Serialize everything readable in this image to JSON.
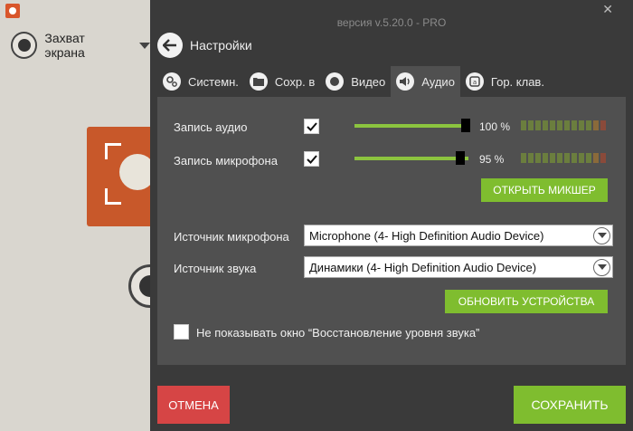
{
  "background_app": {
    "capture_label": "Захват экрана"
  },
  "dialog": {
    "version": "версия v.5.20.0 - PRO",
    "title": "Настройки",
    "tabs": [
      {
        "label": "Системн.",
        "icon": "gear-icon"
      },
      {
        "label": "Сохр. в",
        "icon": "folder-icon"
      },
      {
        "label": "Видео",
        "icon": "record-icon"
      },
      {
        "label": "Аудио",
        "icon": "speaker-icon",
        "active": true
      },
      {
        "label": "Гор. клав.",
        "icon": "hotkey-icon"
      }
    ],
    "audio": {
      "record_audio_label": "Запись аудио",
      "record_audio_checked": true,
      "record_audio_volume": "100 %",
      "record_audio_level": 1.0,
      "record_mic_label": "Запись микрофона",
      "record_mic_checked": true,
      "record_mic_volume": "95 %",
      "record_mic_level": 0.95,
      "open_mixer": "ОТКРЫТЬ МИКШЕР",
      "mic_source_label": "Источник микрофона",
      "mic_source_value": "Microphone (4- High Definition Audio Device)",
      "sound_source_label": "Источник звука",
      "sound_source_value": "Динамики (4- High Definition Audio Device)",
      "refresh_devices": "ОБНОВИТЬ УСТРОЙСТВА",
      "hide_restore_label": "Не показывать окно “Восстановление уровня звука”",
      "hide_restore_checked": false
    },
    "cancel": "ОТМЕНА",
    "save": "СОХРАНИТЬ"
  },
  "colors": {
    "accent_green": "#7fbd2f",
    "cancel_red": "#d64545",
    "dialog_bg": "#3a3a3a",
    "panel_bg": "#505050"
  }
}
